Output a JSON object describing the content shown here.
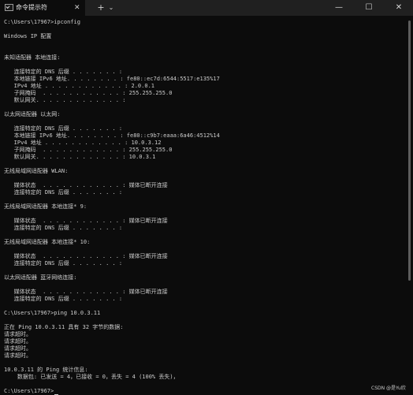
{
  "tab": {
    "title": "命令提示符",
    "close": "✕",
    "new": "+",
    "dropdown": "⌄"
  },
  "window": {
    "minimize": "—",
    "maximize": "☐",
    "close": "✕"
  },
  "lines": [
    "C:\\Users\\17967>ipconfig",
    "",
    "Windows IP 配置",
    "",
    "",
    "未知适配器 本地连接:",
    "",
    "   连接特定的 DNS 后缀 . . . . . . . :",
    "   本地链接 IPv6 地址. . . . . . . . : fe80::ec7d:6544:5517:e135%17",
    "   IPv4 地址 . . . . . . . . . . . . : 2.0.0.1",
    "   子网掩码  . . . . . . . . . . . . : 255.255.255.0",
    "   默认网关. . . . . . . . . . . . . :",
    "",
    "以太网适配器 以太网:",
    "",
    "   连接特定的 DNS 后缀 . . . . . . . :",
    "   本地链接 IPv6 地址. . . . . . . . : fe80::c9b7:eaaa:6a46:4512%14",
    "   IPv4 地址 . . . . . . . . . . . . : 10.0.3.12",
    "   子网掩码  . . . . . . . . . . . . : 255.255.255.0",
    "   默认网关. . . . . . . . . . . . . : 10.0.3.1",
    "",
    "无线局域网适配器 WLAN:",
    "",
    "   媒体状态  . . . . . . . . . . . . : 媒体已断开连接",
    "   连接特定的 DNS 后缀 . . . . . . . :",
    "",
    "无线局域网适配器 本地连接* 9:",
    "",
    "   媒体状态  . . . . . . . . . . . . : 媒体已断开连接",
    "   连接特定的 DNS 后缀 . . . . . . . :",
    "",
    "无线局域网适配器 本地连接* 10:",
    "",
    "   媒体状态  . . . . . . . . . . . . : 媒体已断开连接",
    "   连接特定的 DNS 后缀 . . . . . . . :",
    "",
    "以太网适配器 蓝牙网络连接:",
    "",
    "   媒体状态  . . . . . . . . . . . . : 媒体已断开连接",
    "   连接特定的 DNS 后缀 . . . . . . . :",
    "",
    "C:\\Users\\17967>ping 10.0.3.11",
    "",
    "正在 Ping 10.0.3.11 具有 32 字节的数据:",
    "请求超时。",
    "请求超时。",
    "请求超时。",
    "请求超时。",
    "",
    "10.0.3.11 的 Ping 统计信息:",
    "    数据包: 已发送 = 4，已接收 = 0，丢失 = 4 (100% 丢失)，",
    "",
    "C:\\Users\\17967>"
  ],
  "watermark": "CSDN @是Yu欣"
}
